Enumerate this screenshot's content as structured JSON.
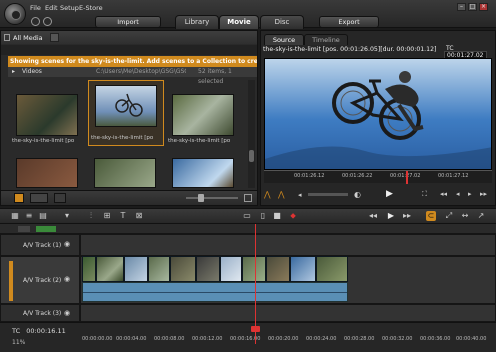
{
  "menu": {
    "file": "File",
    "edit": "Edit",
    "setup": "Setup",
    "estore": "E-Store"
  },
  "top_buttons": {
    "import": "Import",
    "export": "Export"
  },
  "main_tabs": [
    {
      "label": "Library",
      "active": false
    },
    {
      "label": "Movie",
      "active": true
    },
    {
      "label": "Disc",
      "active": false
    }
  ],
  "library": {
    "all_media": "All Media",
    "notice": "Showing scenes for the sky-is-the-limit. Add scenes to a Collection to create clips if",
    "videos_label": "Videos",
    "path": "C:\\Users\\Me\\Desktop\\GSG\\GSG",
    "count": "52 items, 1 selected",
    "thumbs": [
      {
        "label": "the-sky-is-the-limit [po",
        "selected": false
      },
      {
        "label": "the-sky-is-the-limit [po",
        "selected": true
      },
      {
        "label": "the-sky-is-the-limit [po",
        "selected": false
      },
      {
        "label": "",
        "selected": false
      },
      {
        "label": "",
        "selected": false
      },
      {
        "label": "",
        "selected": false
      }
    ]
  },
  "source": {
    "tab_source": "Source",
    "tab_timeline": "Timeline",
    "title": "the-sky-is-the-limit [pos. 00:01:26.05][dur. 00:00:01.12]",
    "tc_label": "TC",
    "tc_value": "00:01:27.02",
    "ruler": [
      "00:01:26.12",
      "00:01:26.22",
      "00:01:27.02",
      "00:01:27.12"
    ]
  },
  "tracks": {
    "t1": "A/V Track (1)",
    "t2": "A/V Track (2)",
    "t3": "A/V Track (3)"
  },
  "timeline": {
    "tc_label": "TC",
    "tc_value": "00:00:16.11",
    "zoom": "11%",
    "ruler": [
      "00:00:00.00",
      "00:00:04.00",
      "00:00:08.00",
      "00:00:12.00",
      "00:00:16.00",
      "00:00:20.00",
      "00:00:24.00",
      "00:00:28.00",
      "00:00:32.00",
      "00:00:36.00",
      "00:00:40.00"
    ]
  },
  "colors": {
    "accent": "#d08a1e",
    "playhead": "#dd3333",
    "audio": "#5a8fb5"
  }
}
